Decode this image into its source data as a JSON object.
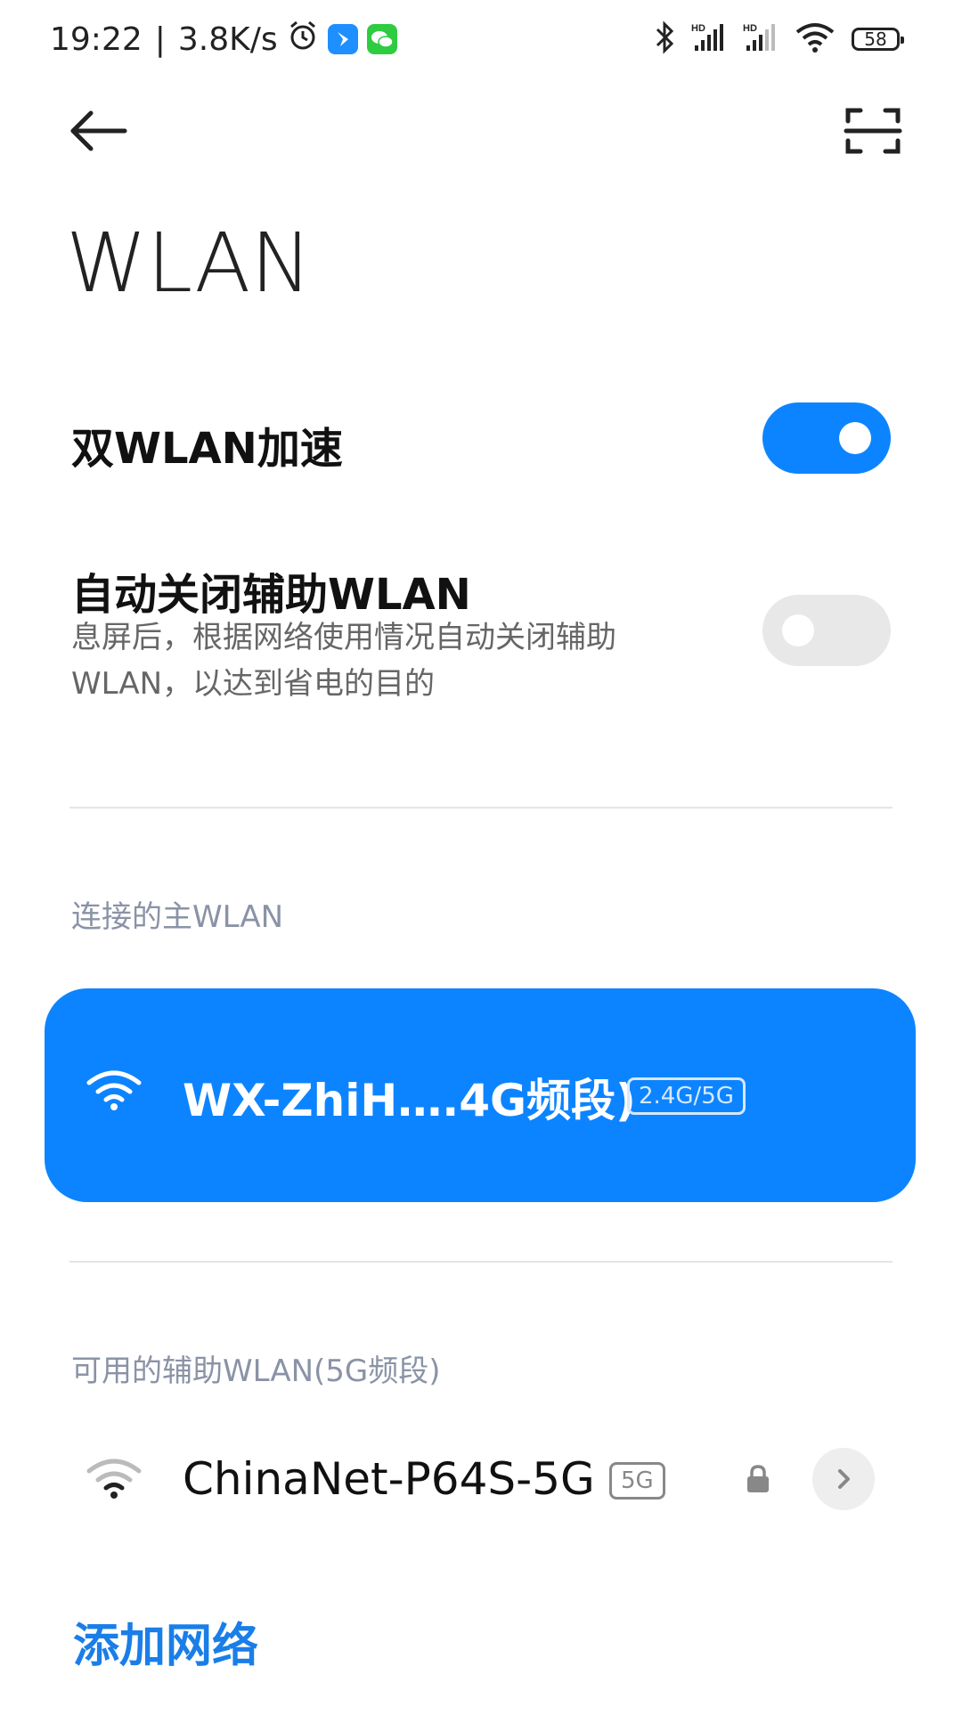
{
  "status_bar": {
    "time": "19:22",
    "speed": "3.8K/s",
    "battery": "58",
    "icons": [
      "alarm-icon",
      "app-icon",
      "wechat-icon",
      "bluetooth-icon",
      "signal-hd-icon",
      "signal-hd-icon",
      "wifi-icon",
      "battery-icon"
    ]
  },
  "header": {
    "title": "WLAN",
    "back_icon": "back-arrow-icon",
    "scan_icon": "scan-icon"
  },
  "dual_wlan": {
    "label": "双WLAN加速",
    "enabled": true
  },
  "auto_close": {
    "label": "自动关闭辅助WLAN",
    "description": "息屏后，根据网络使用情况自动关闭辅助WLAN，以达到省电的目的",
    "enabled": false
  },
  "connected_section": {
    "label": "连接的主WLAN",
    "network": {
      "name": "WX-ZhiH….4G频段)",
      "band": "2.4G/5G",
      "icon": "wifi-icon"
    }
  },
  "available_section": {
    "label": "可用的辅助WLAN(5G频段)",
    "networks": [
      {
        "name": "ChinaNet-P64S-5G",
        "band": "5G",
        "icon": "wifi-icon",
        "secured": true
      }
    ]
  },
  "add_network_label": "添加网络",
  "colors": {
    "accent": "#0d84ff",
    "link": "#1a7ee8",
    "section_label": "#8a93a6"
  }
}
